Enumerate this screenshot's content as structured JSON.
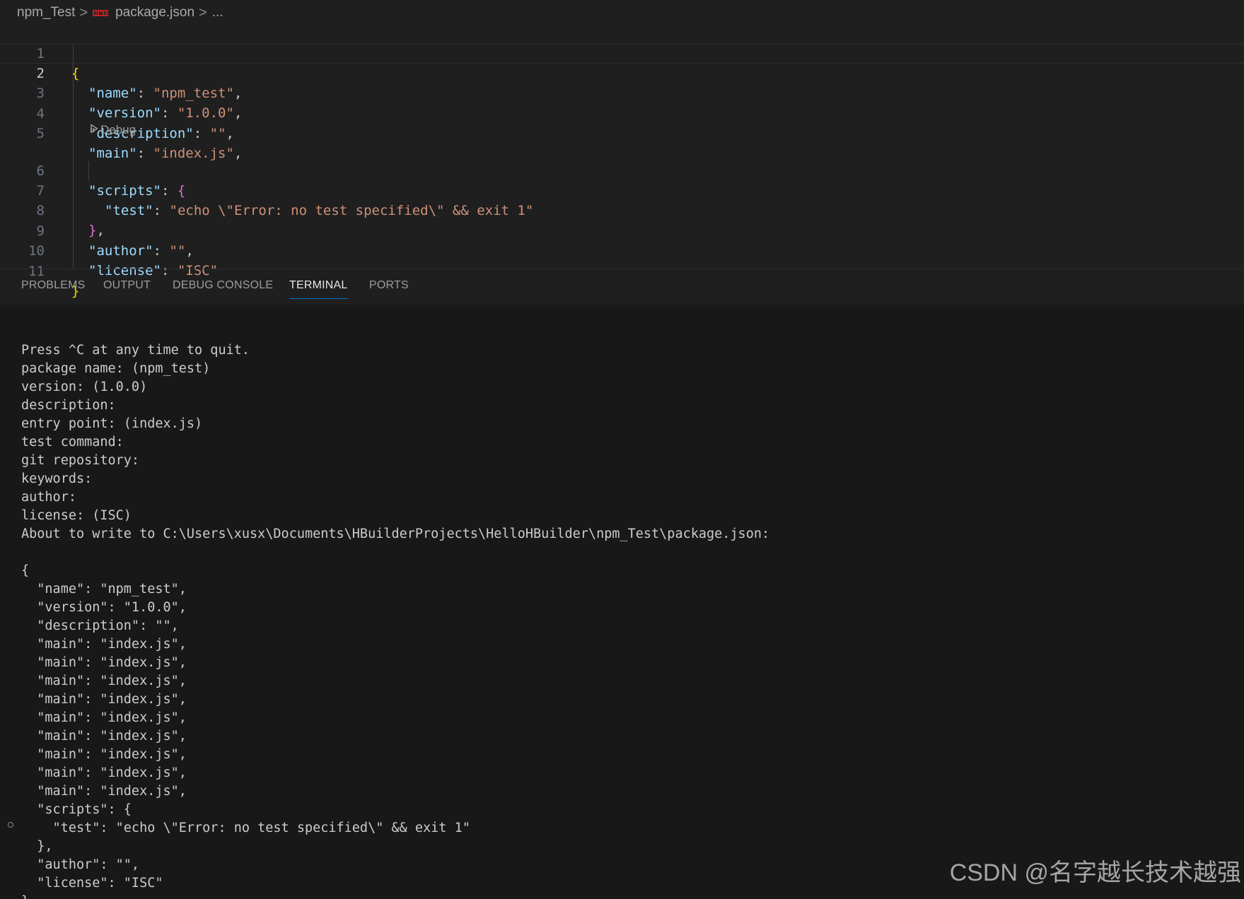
{
  "breadcrumb": {
    "folder": "npm_Test",
    "separator": ">",
    "file": "package.json",
    "more": "..."
  },
  "editor": {
    "current_line": 2,
    "codelens": "Debug",
    "lines": [
      {
        "n": "1",
        "text": "{"
      },
      {
        "n": "2",
        "text": "\"name\": \"npm_test\","
      },
      {
        "n": "3",
        "text": "\"version\": \"1.0.0\","
      },
      {
        "n": "4",
        "text": "\"description\": \"\","
      },
      {
        "n": "5",
        "text": "\"main\": \"index.js\","
      },
      {
        "n": "6",
        "text": "\"scripts\": {"
      },
      {
        "n": "7",
        "text": "\"test\": \"echo \\\"Error: no test specified\\\" && exit 1\""
      },
      {
        "n": "8",
        "text": "},"
      },
      {
        "n": "9",
        "text": "\"author\": \"\","
      },
      {
        "n": "10",
        "text": "\"license\": \"ISC\""
      },
      {
        "n": "11",
        "text": "}"
      }
    ]
  },
  "panel": {
    "tabs": [
      "PROBLEMS",
      "OUTPUT",
      "DEBUG CONSOLE",
      "TERMINAL",
      "PORTS"
    ],
    "active_tab": "TERMINAL"
  },
  "terminal": {
    "lines": [
      "Press ^C at any time to quit.",
      "package name: (npm_test)",
      "version: (1.0.0)",
      "description:",
      "entry point: (index.js)",
      "test command:",
      "git repository:",
      "keywords:",
      "author:",
      "license: (ISC)",
      "About to write to C:\\Users\\xusx\\Documents\\HBuilderProjects\\HelloHBuilder\\npm_Test\\package.json:",
      "",
      "{",
      "  \"name\": \"npm_test\",",
      "  \"version\": \"1.0.0\",",
      "  \"description\": \"\",",
      "  \"main\": \"index.js\",",
      "  \"main\": \"index.js\",",
      "  \"main\": \"index.js\",",
      "  \"main\": \"index.js\",",
      "  \"main\": \"index.js\",",
      "  \"main\": \"index.js\",",
      "  \"main\": \"index.js\",",
      "  \"main\": \"index.js\",",
      "  \"main\": \"index.js\",",
      "  \"scripts\": {",
      "    \"test\": \"echo \\\"Error: no test specified\\\" && exit 1\"",
      "  },",
      "  \"author\": \"\",",
      "  \"license\": \"ISC\"",
      "}"
    ]
  },
  "watermark": "CSDN @名字越长技术越强",
  "colors": {
    "editor_bg": "#1f1f1f",
    "terminal_bg": "#181818",
    "json_key": "#9cdcfe",
    "json_string": "#ce9178",
    "brace_level1": "#ffd700",
    "brace_level2": "#da70d6",
    "active_tab_underline": "#0078d4",
    "npm_icon": "#c12127"
  },
  "icons": {
    "file_icon": "npm-icon",
    "codelens_icon": "play-icon",
    "terminal_marker": "command-decoration-icon"
  }
}
